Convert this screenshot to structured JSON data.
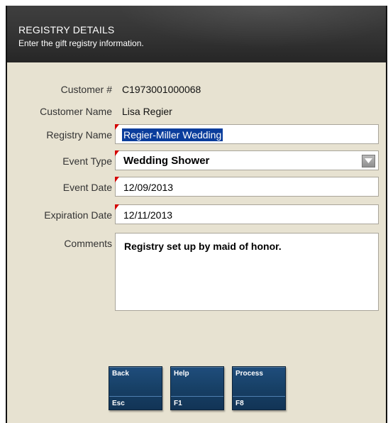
{
  "header": {
    "title": "REGISTRY DETAILS",
    "subtitle": "Enter the gift registry information."
  },
  "form": {
    "customer_number_label": "Customer #",
    "customer_number_value": "C1973001000068",
    "customer_name_label": "Customer Name",
    "customer_name_value": "Lisa Regier",
    "registry_name_label": "Registry Name",
    "registry_name_value": "Regier-Miller Wedding",
    "event_type_label": "Event Type",
    "event_type_value": "Wedding Shower",
    "event_date_label": "Event Date",
    "event_date_value": "12/09/2013",
    "expiration_date_label": "Expiration Date",
    "expiration_date_value": "12/11/2013",
    "comments_label": "Comments",
    "comments_value": "Registry set up by maid of honor."
  },
  "buttons": [
    {
      "label": "Back",
      "key": "Esc"
    },
    {
      "label": "Help",
      "key": "F1"
    },
    {
      "label": "Process",
      "key": "F8"
    }
  ],
  "colors": {
    "header_bg": "#333333",
    "panel_bg": "#e7e2d1",
    "button_bg": "#174066",
    "required_marker": "#d40000",
    "selection": "#0a3d9c"
  },
  "icons": {
    "dropdown": "chevron-down-icon",
    "required": "required-marker-icon"
  }
}
